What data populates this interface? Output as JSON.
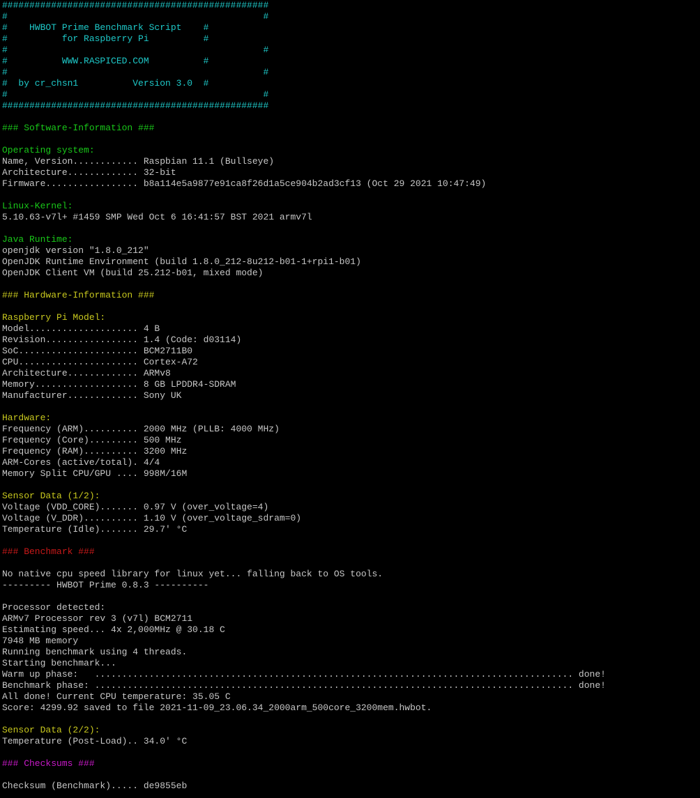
{
  "window": {
    "type": "terminal",
    "colors": {
      "background": "#000000",
      "default": "#c7c7c7",
      "cyan": "#1ec8c8",
      "green": "#19c819",
      "yellow": "#c8c81e",
      "red": "#c81919",
      "magenta": "#c819c8"
    }
  },
  "lines": [
    {
      "text": "#################################################",
      "color": "cyan"
    },
    {
      "text": "#                                               #",
      "color": "cyan"
    },
    {
      "text": "#    HWBOT Prime Benchmark Script    #",
      "color": "cyan"
    },
    {
      "text": "#          for Raspberry Pi          #",
      "color": "cyan"
    },
    {
      "text": "#                                               #",
      "color": "cyan"
    },
    {
      "text": "#          WWW.RASPICED.COM          #",
      "color": "cyan"
    },
    {
      "text": "#                                               #",
      "color": "cyan"
    },
    {
      "text": "#  by cr_chsn1          Version 3.0  #",
      "color": "cyan"
    },
    {
      "text": "#                                               #",
      "color": "cyan"
    },
    {
      "text": "#################################################",
      "color": "cyan"
    },
    {
      "text": "",
      "color": "white"
    },
    {
      "text": "### Software-Information ###",
      "color": "green"
    },
    {
      "text": "",
      "color": "white"
    },
    {
      "text": "Operating system:",
      "color": "green"
    },
    {
      "text": "Name, Version............ Raspbian 11.1 (Bullseye)",
      "color": "white"
    },
    {
      "text": "Architecture............. 32-bit",
      "color": "white"
    },
    {
      "text": "Firmware................. b8a114e5a9877e91ca8f26d1a5ce904b2ad3cf13 (Oct 29 2021 10:47:49)",
      "color": "white"
    },
    {
      "text": "",
      "color": "white"
    },
    {
      "text": "Linux-Kernel:",
      "color": "green"
    },
    {
      "text": "5.10.63-v7l+ #1459 SMP Wed Oct 6 16:41:57 BST 2021 armv7l",
      "color": "white"
    },
    {
      "text": "",
      "color": "white"
    },
    {
      "text": "Java Runtime:",
      "color": "green"
    },
    {
      "text": "openjdk version \"1.8.0_212\"",
      "color": "white"
    },
    {
      "text": "OpenJDK Runtime Environment (build 1.8.0_212-8u212-b01-1+rpi1-b01)",
      "color": "white"
    },
    {
      "text": "OpenJDK Client VM (build 25.212-b01, mixed mode)",
      "color": "white"
    },
    {
      "text": "",
      "color": "white"
    },
    {
      "text": "### Hardware-Information ###",
      "color": "yellow"
    },
    {
      "text": "",
      "color": "white"
    },
    {
      "text": "Raspberry Pi Model:",
      "color": "yellow"
    },
    {
      "text": "Model.................... 4 B",
      "color": "white"
    },
    {
      "text": "Revision................. 1.4 (Code: d03114)",
      "color": "white"
    },
    {
      "text": "SoC...................... BCM2711B0",
      "color": "white"
    },
    {
      "text": "CPU...................... Cortex-A72",
      "color": "white"
    },
    {
      "text": "Architecture............. ARMv8",
      "color": "white"
    },
    {
      "text": "Memory................... 8 GB LPDDR4-SDRAM",
      "color": "white"
    },
    {
      "text": "Manufacturer............. Sony UK",
      "color": "white"
    },
    {
      "text": "",
      "color": "white"
    },
    {
      "text": "Hardware:",
      "color": "yellow"
    },
    {
      "text": "Frequency (ARM).......... 2000 MHz (PLLB: 4000 MHz)",
      "color": "white"
    },
    {
      "text": "Frequency (Core)......... 500 MHz",
      "color": "white"
    },
    {
      "text": "Frequency (RAM).......... 3200 MHz",
      "color": "white"
    },
    {
      "text": "ARM-Cores (active/total). 4/4",
      "color": "white"
    },
    {
      "text": "Memory Split CPU/GPU .... 998M/16M",
      "color": "white"
    },
    {
      "text": "",
      "color": "white"
    },
    {
      "text": "Sensor Data (1/2):",
      "color": "yellow"
    },
    {
      "text": "Voltage (VDD_CORE)....... 0.97 V (over_voltage=4)",
      "color": "white"
    },
    {
      "text": "Voltage (V_DDR).......... 1.10 V (over_voltage_sdram=0)",
      "color": "white"
    },
    {
      "text": "Temperature (Idle)....... 29.7' °C",
      "color": "white"
    },
    {
      "text": "",
      "color": "white"
    },
    {
      "text": "### Benchmark ###",
      "color": "red"
    },
    {
      "text": "",
      "color": "white"
    },
    {
      "text": "No native cpu speed library for linux yet... falling back to OS tools.",
      "color": "white"
    },
    {
      "text": "--------- HWBOT Prime 0.8.3 ----------",
      "color": "white"
    },
    {
      "text": "",
      "color": "white"
    },
    {
      "text": "Processor detected:",
      "color": "white"
    },
    {
      "text": "ARMv7 Processor rev 3 (v7l) BCM2711",
      "color": "white"
    },
    {
      "text": "Estimating speed... 4x 2,000MHz @ 30.18 C",
      "color": "white"
    },
    {
      "text": "7948 MB memory",
      "color": "white"
    },
    {
      "text": "Running benchmark using 4 threads.",
      "color": "white"
    },
    {
      "text": "Starting benchmark...",
      "color": "white"
    },
    {
      "text": "Warm up phase:   ........................................................................................ done!",
      "color": "white"
    },
    {
      "text": "Benchmark phase: ........................................................................................ done!",
      "color": "white"
    },
    {
      "text": "All done! Current CPU temperature: 35.05 C",
      "color": "white"
    },
    {
      "text": "Score: 4299.92 saved to file 2021-11-09_23.06.34_2000arm_500core_3200mem.hwbot.",
      "color": "white"
    },
    {
      "text": "",
      "color": "white"
    },
    {
      "text": "Sensor Data (2/2):",
      "color": "yellow"
    },
    {
      "text": "Temperature (Post-Load).. 34.0' °C",
      "color": "white"
    },
    {
      "text": "",
      "color": "white"
    },
    {
      "text": "### Checksums ###",
      "color": "magenta"
    },
    {
      "text": "",
      "color": "white"
    },
    {
      "text": "Checksum (Benchmark)..... de9855eb",
      "color": "white"
    }
  ]
}
